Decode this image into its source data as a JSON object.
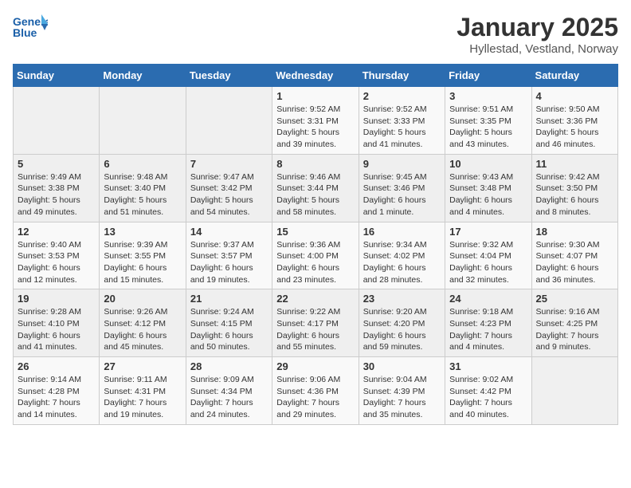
{
  "header": {
    "logo_line1": "General",
    "logo_line2": "Blue",
    "title": "January 2025",
    "subtitle": "Hyllestad, Vestland, Norway"
  },
  "weekdays": [
    "Sunday",
    "Monday",
    "Tuesday",
    "Wednesday",
    "Thursday",
    "Friday",
    "Saturday"
  ],
  "weeks": [
    [
      {
        "day": "",
        "info": ""
      },
      {
        "day": "",
        "info": ""
      },
      {
        "day": "",
        "info": ""
      },
      {
        "day": "1",
        "info": "Sunrise: 9:52 AM\nSunset: 3:31 PM\nDaylight: 5 hours\nand 39 minutes."
      },
      {
        "day": "2",
        "info": "Sunrise: 9:52 AM\nSunset: 3:33 PM\nDaylight: 5 hours\nand 41 minutes."
      },
      {
        "day": "3",
        "info": "Sunrise: 9:51 AM\nSunset: 3:35 PM\nDaylight: 5 hours\nand 43 minutes."
      },
      {
        "day": "4",
        "info": "Sunrise: 9:50 AM\nSunset: 3:36 PM\nDaylight: 5 hours\nand 46 minutes."
      }
    ],
    [
      {
        "day": "5",
        "info": "Sunrise: 9:49 AM\nSunset: 3:38 PM\nDaylight: 5 hours\nand 49 minutes."
      },
      {
        "day": "6",
        "info": "Sunrise: 9:48 AM\nSunset: 3:40 PM\nDaylight: 5 hours\nand 51 minutes."
      },
      {
        "day": "7",
        "info": "Sunrise: 9:47 AM\nSunset: 3:42 PM\nDaylight: 5 hours\nand 54 minutes."
      },
      {
        "day": "8",
        "info": "Sunrise: 9:46 AM\nSunset: 3:44 PM\nDaylight: 5 hours\nand 58 minutes."
      },
      {
        "day": "9",
        "info": "Sunrise: 9:45 AM\nSunset: 3:46 PM\nDaylight: 6 hours\nand 1 minute."
      },
      {
        "day": "10",
        "info": "Sunrise: 9:43 AM\nSunset: 3:48 PM\nDaylight: 6 hours\nand 4 minutes."
      },
      {
        "day": "11",
        "info": "Sunrise: 9:42 AM\nSunset: 3:50 PM\nDaylight: 6 hours\nand 8 minutes."
      }
    ],
    [
      {
        "day": "12",
        "info": "Sunrise: 9:40 AM\nSunset: 3:53 PM\nDaylight: 6 hours\nand 12 minutes."
      },
      {
        "day": "13",
        "info": "Sunrise: 9:39 AM\nSunset: 3:55 PM\nDaylight: 6 hours\nand 15 minutes."
      },
      {
        "day": "14",
        "info": "Sunrise: 9:37 AM\nSunset: 3:57 PM\nDaylight: 6 hours\nand 19 minutes."
      },
      {
        "day": "15",
        "info": "Sunrise: 9:36 AM\nSunset: 4:00 PM\nDaylight: 6 hours\nand 23 minutes."
      },
      {
        "day": "16",
        "info": "Sunrise: 9:34 AM\nSunset: 4:02 PM\nDaylight: 6 hours\nand 28 minutes."
      },
      {
        "day": "17",
        "info": "Sunrise: 9:32 AM\nSunset: 4:04 PM\nDaylight: 6 hours\nand 32 minutes."
      },
      {
        "day": "18",
        "info": "Sunrise: 9:30 AM\nSunset: 4:07 PM\nDaylight: 6 hours\nand 36 minutes."
      }
    ],
    [
      {
        "day": "19",
        "info": "Sunrise: 9:28 AM\nSunset: 4:10 PM\nDaylight: 6 hours\nand 41 minutes."
      },
      {
        "day": "20",
        "info": "Sunrise: 9:26 AM\nSunset: 4:12 PM\nDaylight: 6 hours\nand 45 minutes."
      },
      {
        "day": "21",
        "info": "Sunrise: 9:24 AM\nSunset: 4:15 PM\nDaylight: 6 hours\nand 50 minutes."
      },
      {
        "day": "22",
        "info": "Sunrise: 9:22 AM\nSunset: 4:17 PM\nDaylight: 6 hours\nand 55 minutes."
      },
      {
        "day": "23",
        "info": "Sunrise: 9:20 AM\nSunset: 4:20 PM\nDaylight: 6 hours\nand 59 minutes."
      },
      {
        "day": "24",
        "info": "Sunrise: 9:18 AM\nSunset: 4:23 PM\nDaylight: 7 hours\nand 4 minutes."
      },
      {
        "day": "25",
        "info": "Sunrise: 9:16 AM\nSunset: 4:25 PM\nDaylight: 7 hours\nand 9 minutes."
      }
    ],
    [
      {
        "day": "26",
        "info": "Sunrise: 9:14 AM\nSunset: 4:28 PM\nDaylight: 7 hours\nand 14 minutes."
      },
      {
        "day": "27",
        "info": "Sunrise: 9:11 AM\nSunset: 4:31 PM\nDaylight: 7 hours\nand 19 minutes."
      },
      {
        "day": "28",
        "info": "Sunrise: 9:09 AM\nSunset: 4:34 PM\nDaylight: 7 hours\nand 24 minutes."
      },
      {
        "day": "29",
        "info": "Sunrise: 9:06 AM\nSunset: 4:36 PM\nDaylight: 7 hours\nand 29 minutes."
      },
      {
        "day": "30",
        "info": "Sunrise: 9:04 AM\nSunset: 4:39 PM\nDaylight: 7 hours\nand 35 minutes."
      },
      {
        "day": "31",
        "info": "Sunrise: 9:02 AM\nSunset: 4:42 PM\nDaylight: 7 hours\nand 40 minutes."
      },
      {
        "day": "",
        "info": ""
      }
    ]
  ]
}
